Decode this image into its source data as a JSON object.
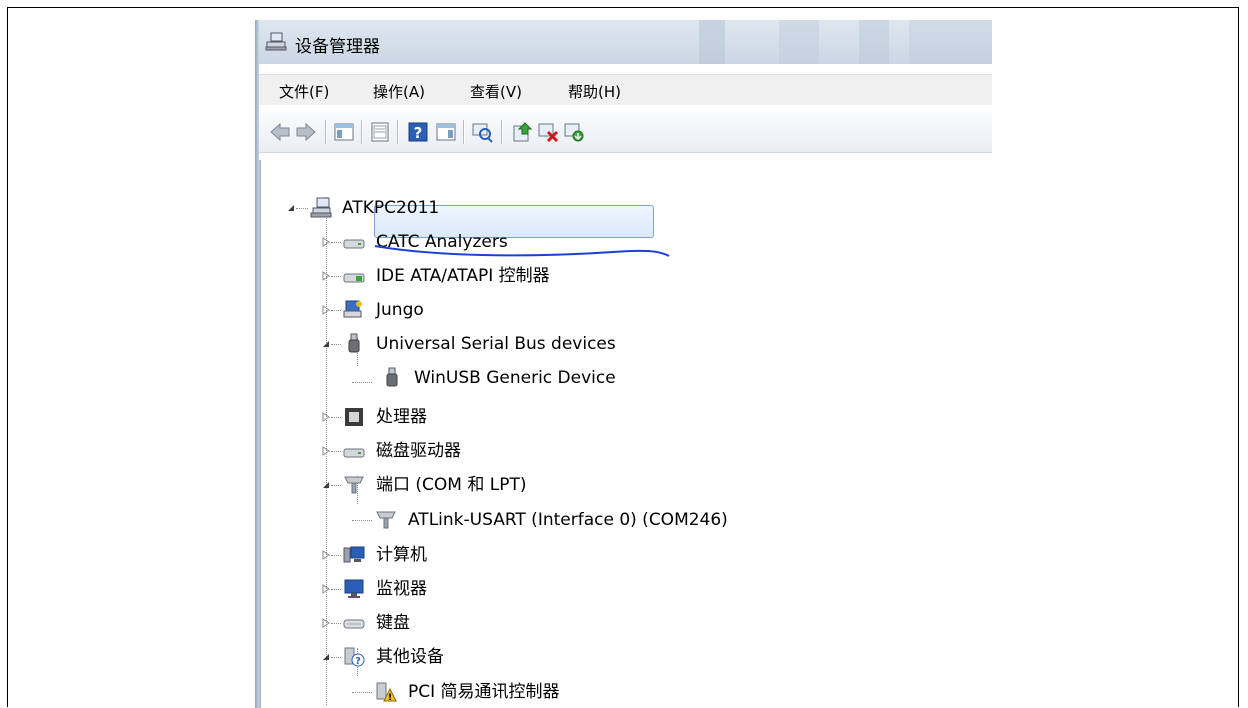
{
  "window": {
    "title": "设备管理器"
  },
  "menu": [
    "文件(F)",
    "操作(A)",
    "查看(V)",
    "帮助(H)"
  ],
  "toolbar": [
    "back-arrow-icon",
    "forward-arrow-icon",
    "show-hide-console-tree-icon",
    "properties-icon",
    "help-icon",
    "show-action-pane-icon",
    "scan-hardware-icon",
    "update-driver-icon",
    "disable-device-icon",
    "uninstall-device-icon"
  ],
  "tree": {
    "root": "ATKPC2011",
    "items": {
      "catc": "CATC Analyzers",
      "ide": "IDE ATA/ATAPI 控制器",
      "jungo": "Jungo",
      "usb": "Universal Serial Bus devices",
      "winusb": "WinUSB Generic Device",
      "cpu": "处理器",
      "disk": "磁盘驱动器",
      "ports": "端口 (COM 和 LPT)",
      "atlink": "ATLink-USART (Interface 0) (COM246)",
      "computer": "计算机",
      "monitor": "监视器",
      "keyboard": "键盘",
      "other": "其他设备",
      "pci": "PCI 简易通讯控制器"
    }
  },
  "colors": {
    "selection_border": "#7da2ce",
    "annotation": "#1e3fd6",
    "toolbar_bg": "#eef1f5"
  }
}
